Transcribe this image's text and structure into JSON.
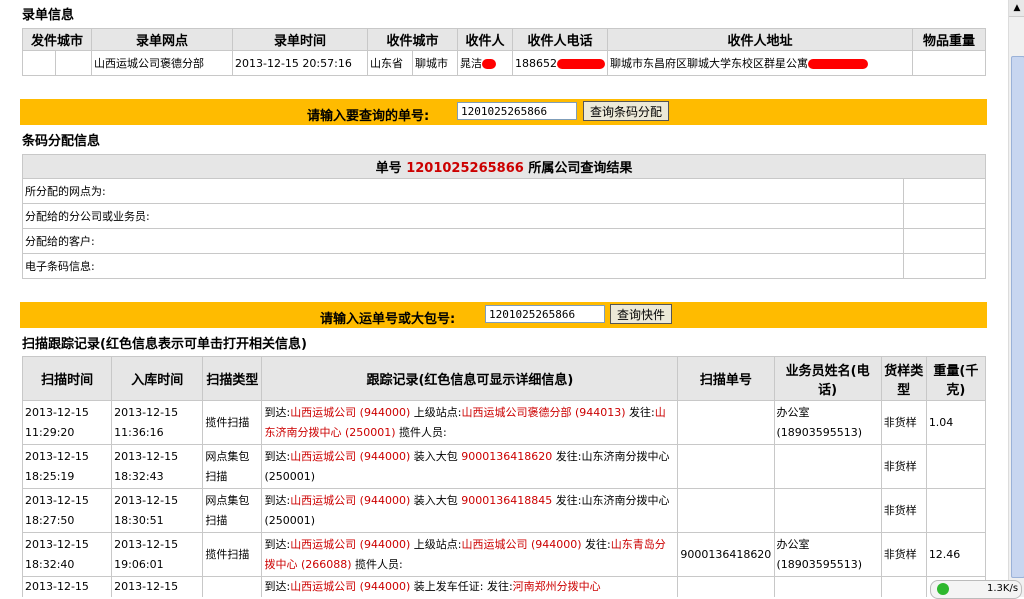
{
  "record": {
    "title": "录单信息",
    "headers": [
      "发件城市",
      "录单网点",
      "录单时间",
      "收件城市",
      "收件人",
      "收件人电话",
      "收件人地址",
      "物品重量"
    ],
    "row": {
      "branch": "山西运城公司褒德分部",
      "time": "2013-12-15 20:57:16",
      "province": "山东省",
      "city": "聊城市",
      "receiver": "晁洁",
      "phone": "188652",
      "address": "聊城市东昌府区聊城大学东校区群星公寓"
    }
  },
  "query1": {
    "label": "请输入要查询的单号:",
    "value": "1201025265866",
    "button": "查询条码分配"
  },
  "assign": {
    "title": "条码分配信息",
    "header_prefix": "单号",
    "header_number": "1201025265866",
    "header_suffix": "所属公司查询结果",
    "rows": [
      "所分配的网点为:",
      "分配给的分公司或业务员:",
      "分配给的客户:",
      "电子条码信息:"
    ]
  },
  "query2": {
    "label": "请输入运单号或大包号:",
    "value": "1201025265866",
    "button": "查询快件"
  },
  "scan": {
    "title": "扫描跟踪记录(红色信息表示可单击打开相关信息)",
    "headers": [
      "扫描时间",
      "入库时间",
      "扫描类型",
      "跟踪记录(红色信息可显示详细信息)",
      "扫描单号",
      "业务员姓名(电话)",
      "货样类型",
      "重量(千克)"
    ],
    "rows": [
      {
        "scan_time": "2013-12-15 11:29:20",
        "in_time": "2013-12-15 11:36:16",
        "type": "揽件扫描",
        "t1": "到达:",
        "r1": "山西运城公司 (944000)",
        "t2": " 上级站点:",
        "r2": "山西运城公司褒德分部 (944013)",
        "t3": " 发往:",
        "r3": "山东济南分拨中心 (250001)",
        "t4": " 揽件人员:",
        "scan_no": "",
        "staff": "办公室 (18903595513)",
        "sample": "非货样",
        "weight": "1.04"
      },
      {
        "scan_time": "2013-12-15 18:25:19",
        "in_time": "2013-12-15 18:32:43",
        "type": "网点集包扫描",
        "t1": "到达:",
        "r1": "山西运城公司 (944000)",
        "t2": " 装入大包 ",
        "r2": "9000136418620",
        "t3": " 发往:山东济南分拨中心 (250001)",
        "scan_no": "",
        "staff": "",
        "sample": "非货样",
        "weight": ""
      },
      {
        "scan_time": "2013-12-15 18:27:50",
        "in_time": "2013-12-15 18:30:51",
        "type": "网点集包扫描",
        "t1": "到达:",
        "r1": "山西运城公司 (944000)",
        "t2": " 装入大包 ",
        "r2": "9000136418845",
        "t3": " 发往:山东济南分拨中心 (250001)",
        "scan_no": "",
        "staff": "",
        "sample": "非货样",
        "weight": ""
      },
      {
        "scan_time": "2013-12-15 18:32:40",
        "in_time": "2013-12-15 19:06:01",
        "type": "揽件扫描",
        "t1": "到达:",
        "r1": "山西运城公司 (944000)",
        "t2": " 上级站点:",
        "r2": "山西运城公司 (944000)",
        "t3": " 发往:",
        "r3": "山东青岛分拨中心 (266088)",
        "t4": " 揽件人员:",
        "scan_no": "9000136418620",
        "staff": "办公室 (18903595513)",
        "sample": "非货样",
        "weight": "12.46"
      },
      {
        "scan_time": "2013-12-15",
        "in_time": "2013-12-15",
        "t1": "到达:",
        "r1": "山西运城公司 (944000)",
        "t2": " 装上发车任证: 发往:",
        "r2": "河南郑州分拨中心"
      }
    ]
  },
  "status": {
    "speed": "1.3K/s"
  },
  "colors": {
    "accent": "#ffbb00",
    "link_red": "#cc0000",
    "header_bg": "#e6e6e6"
  }
}
